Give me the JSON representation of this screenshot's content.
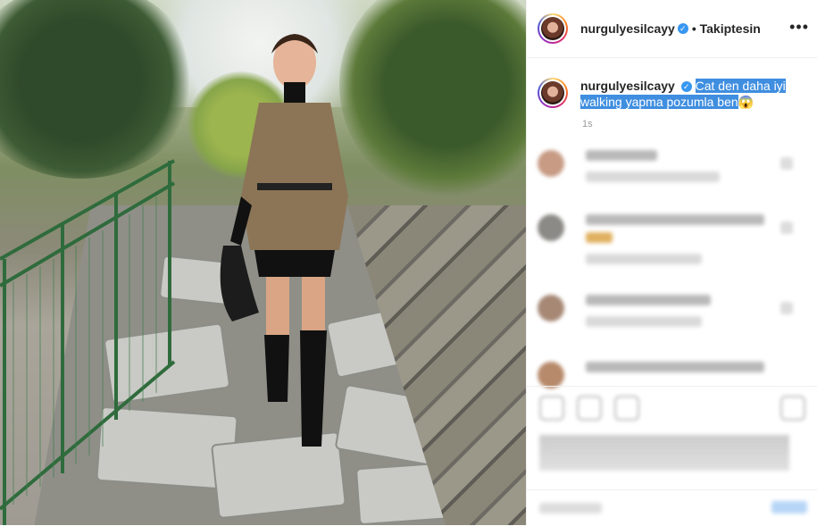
{
  "post": {
    "username": "nurgulyesilcayy",
    "verified_icon": "verified-badge-icon",
    "follow_status": "• Takiptesin",
    "more_icon": "more-options-icon",
    "caption_text_line1": "Cat den daha iyi",
    "caption_text_line2": "walking yapma pozumla ben",
    "caption_emoji": "😱",
    "time_ago": "1s"
  },
  "colors": {
    "accent": "#3897f0",
    "selection": "#3f8ee0"
  }
}
